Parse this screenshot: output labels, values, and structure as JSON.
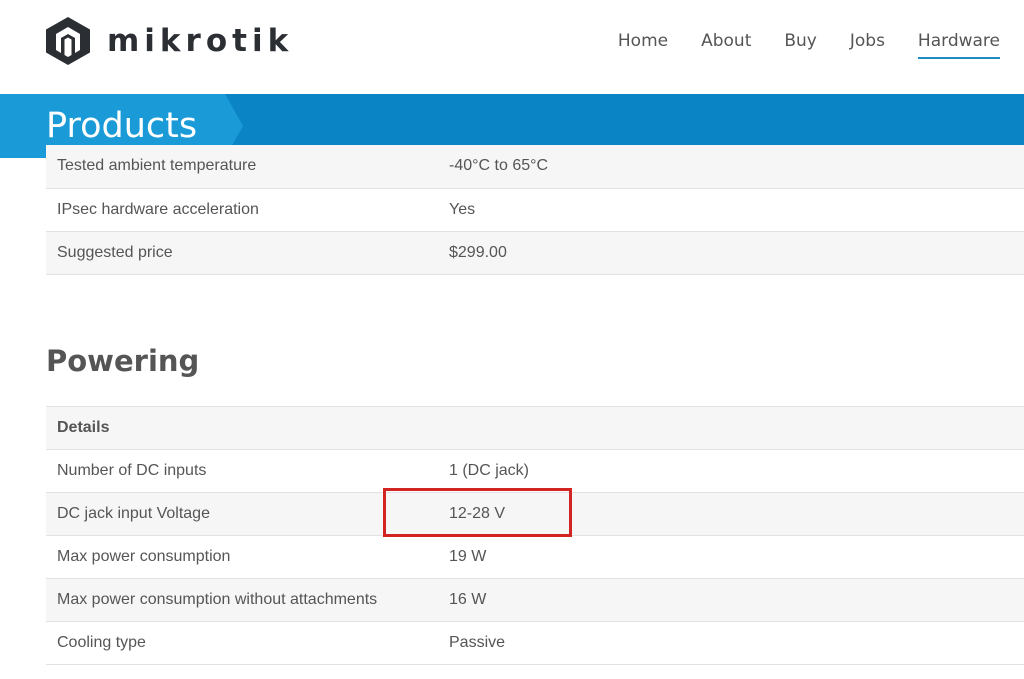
{
  "header": {
    "brand": "mikrotik",
    "nav": [
      {
        "label": "Home",
        "active": false
      },
      {
        "label": "About",
        "active": false
      },
      {
        "label": "Buy",
        "active": false
      },
      {
        "label": "Jobs",
        "active": false
      },
      {
        "label": "Hardware",
        "active": true
      }
    ]
  },
  "banner": {
    "title": "Products"
  },
  "specs_top": [
    {
      "label": "Tested ambient temperature",
      "value": "-40°C to 65°C"
    },
    {
      "label": "IPsec hardware acceleration",
      "value": "Yes"
    },
    {
      "label": "Suggested price",
      "value": "$299.00"
    }
  ],
  "powering": {
    "title": "Powering",
    "details_header": "Details",
    "rows": [
      {
        "label": "Number of DC inputs",
        "value": "1 (DC jack)"
      },
      {
        "label": "DC jack input Voltage",
        "value": "12-28 V"
      },
      {
        "label": "Max power consumption",
        "value": "19 W"
      },
      {
        "label": "Max power consumption without attachments",
        "value": "16 W"
      },
      {
        "label": "Cooling type",
        "value": "Passive"
      }
    ]
  },
  "colors": {
    "banner": "#0b84c5",
    "banner_accent": "#1a9bd8",
    "nav_active_underline": "#1e8bc3",
    "highlight": "#d32424",
    "text": "#555555"
  }
}
